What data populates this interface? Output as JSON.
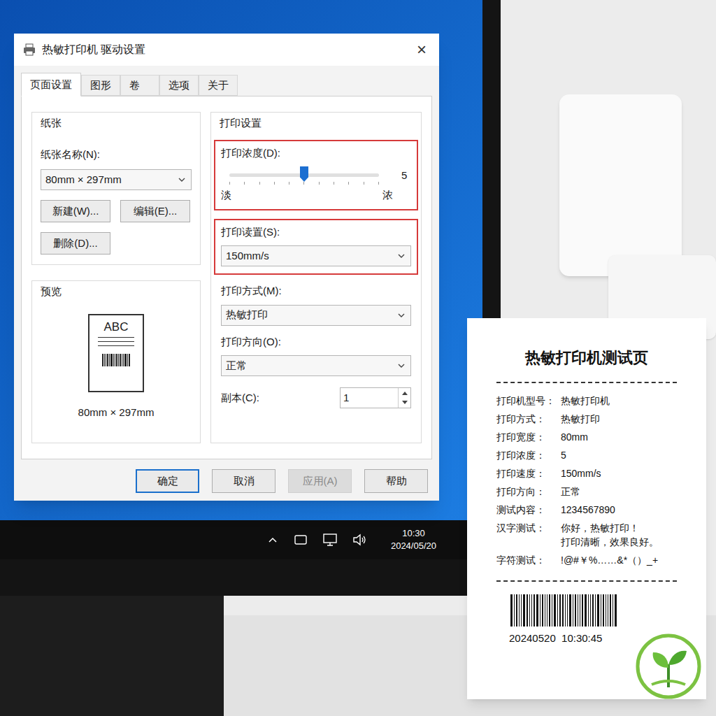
{
  "window": {
    "title": "热敏打印机 驱动设置",
    "close": "×"
  },
  "tabs": [
    {
      "label": "页面设置",
      "selected": true
    },
    {
      "label": "图形",
      "selected": false
    },
    {
      "label": "卷",
      "selected": false
    },
    {
      "label": "选项",
      "selected": false
    },
    {
      "label": "关于",
      "selected": false
    }
  ],
  "paper": {
    "group": "纸张",
    "name_label": "纸张名称(N):",
    "name_value": "80mm × 297mm",
    "buttons": [
      "新建(W)...",
      "编辑(E)...",
      "删除(D)..."
    ],
    "preview_label": "预览",
    "preview_text": "ABC",
    "preview_size": "80mm × 297mm"
  },
  "print_settings": {
    "group": "打印设置",
    "density": {
      "label": "打印浓度(D):",
      "level": 0.5,
      "reading": "5",
      "min_label": "淡",
      "max_label": "浓",
      "highlighted": true
    },
    "speed": {
      "label": "打印读置(S):",
      "value": "150mm/s",
      "highlighted": true
    },
    "mode": {
      "label": "打印方式(M):",
      "value": "热敏打印"
    },
    "direction": {
      "label": "打印方向(O):",
      "value": "正常"
    },
    "copies": {
      "label": "副本(C):",
      "value": "1"
    }
  },
  "buttons": [
    {
      "label": "确定",
      "disabled": false,
      "default": true
    },
    {
      "label": "取消",
      "disabled": false,
      "default": false
    },
    {
      "label": "应用(A)",
      "disabled": true,
      "default": false
    },
    {
      "label": "帮助",
      "disabled": false,
      "default": false
    }
  ],
  "taskbar": {
    "time": "10:30",
    "date": "2024/05/20"
  },
  "receipt": {
    "title": "热敏打印机测试页",
    "rows": [
      {
        "label": "打印机型号：",
        "values": [
          "热敏打印机"
        ]
      },
      {
        "label": "打印方式：",
        "values": [
          "热敏打印"
        ]
      },
      {
        "label": "打印宽度：",
        "values": [
          "80mm"
        ]
      },
      {
        "label": "打印浓度：",
        "values": [
          "5"
        ]
      },
      {
        "label": "打印速度：",
        "values": [
          "150mm/s"
        ]
      },
      {
        "label": "打印方向：",
        "values": [
          "正常"
        ]
      },
      {
        "label": "测试内容：",
        "values": [
          "1234567890"
        ]
      },
      {
        "label": "汉字测试：",
        "values": [
          "你好，热敏打印！",
          "打印清晰，效果良好。"
        ]
      },
      {
        "label": "字符测试：",
        "values": [
          "!@#￥%……&*（）_+"
        ]
      }
    ],
    "footer": "20240520  10:30:45"
  }
}
